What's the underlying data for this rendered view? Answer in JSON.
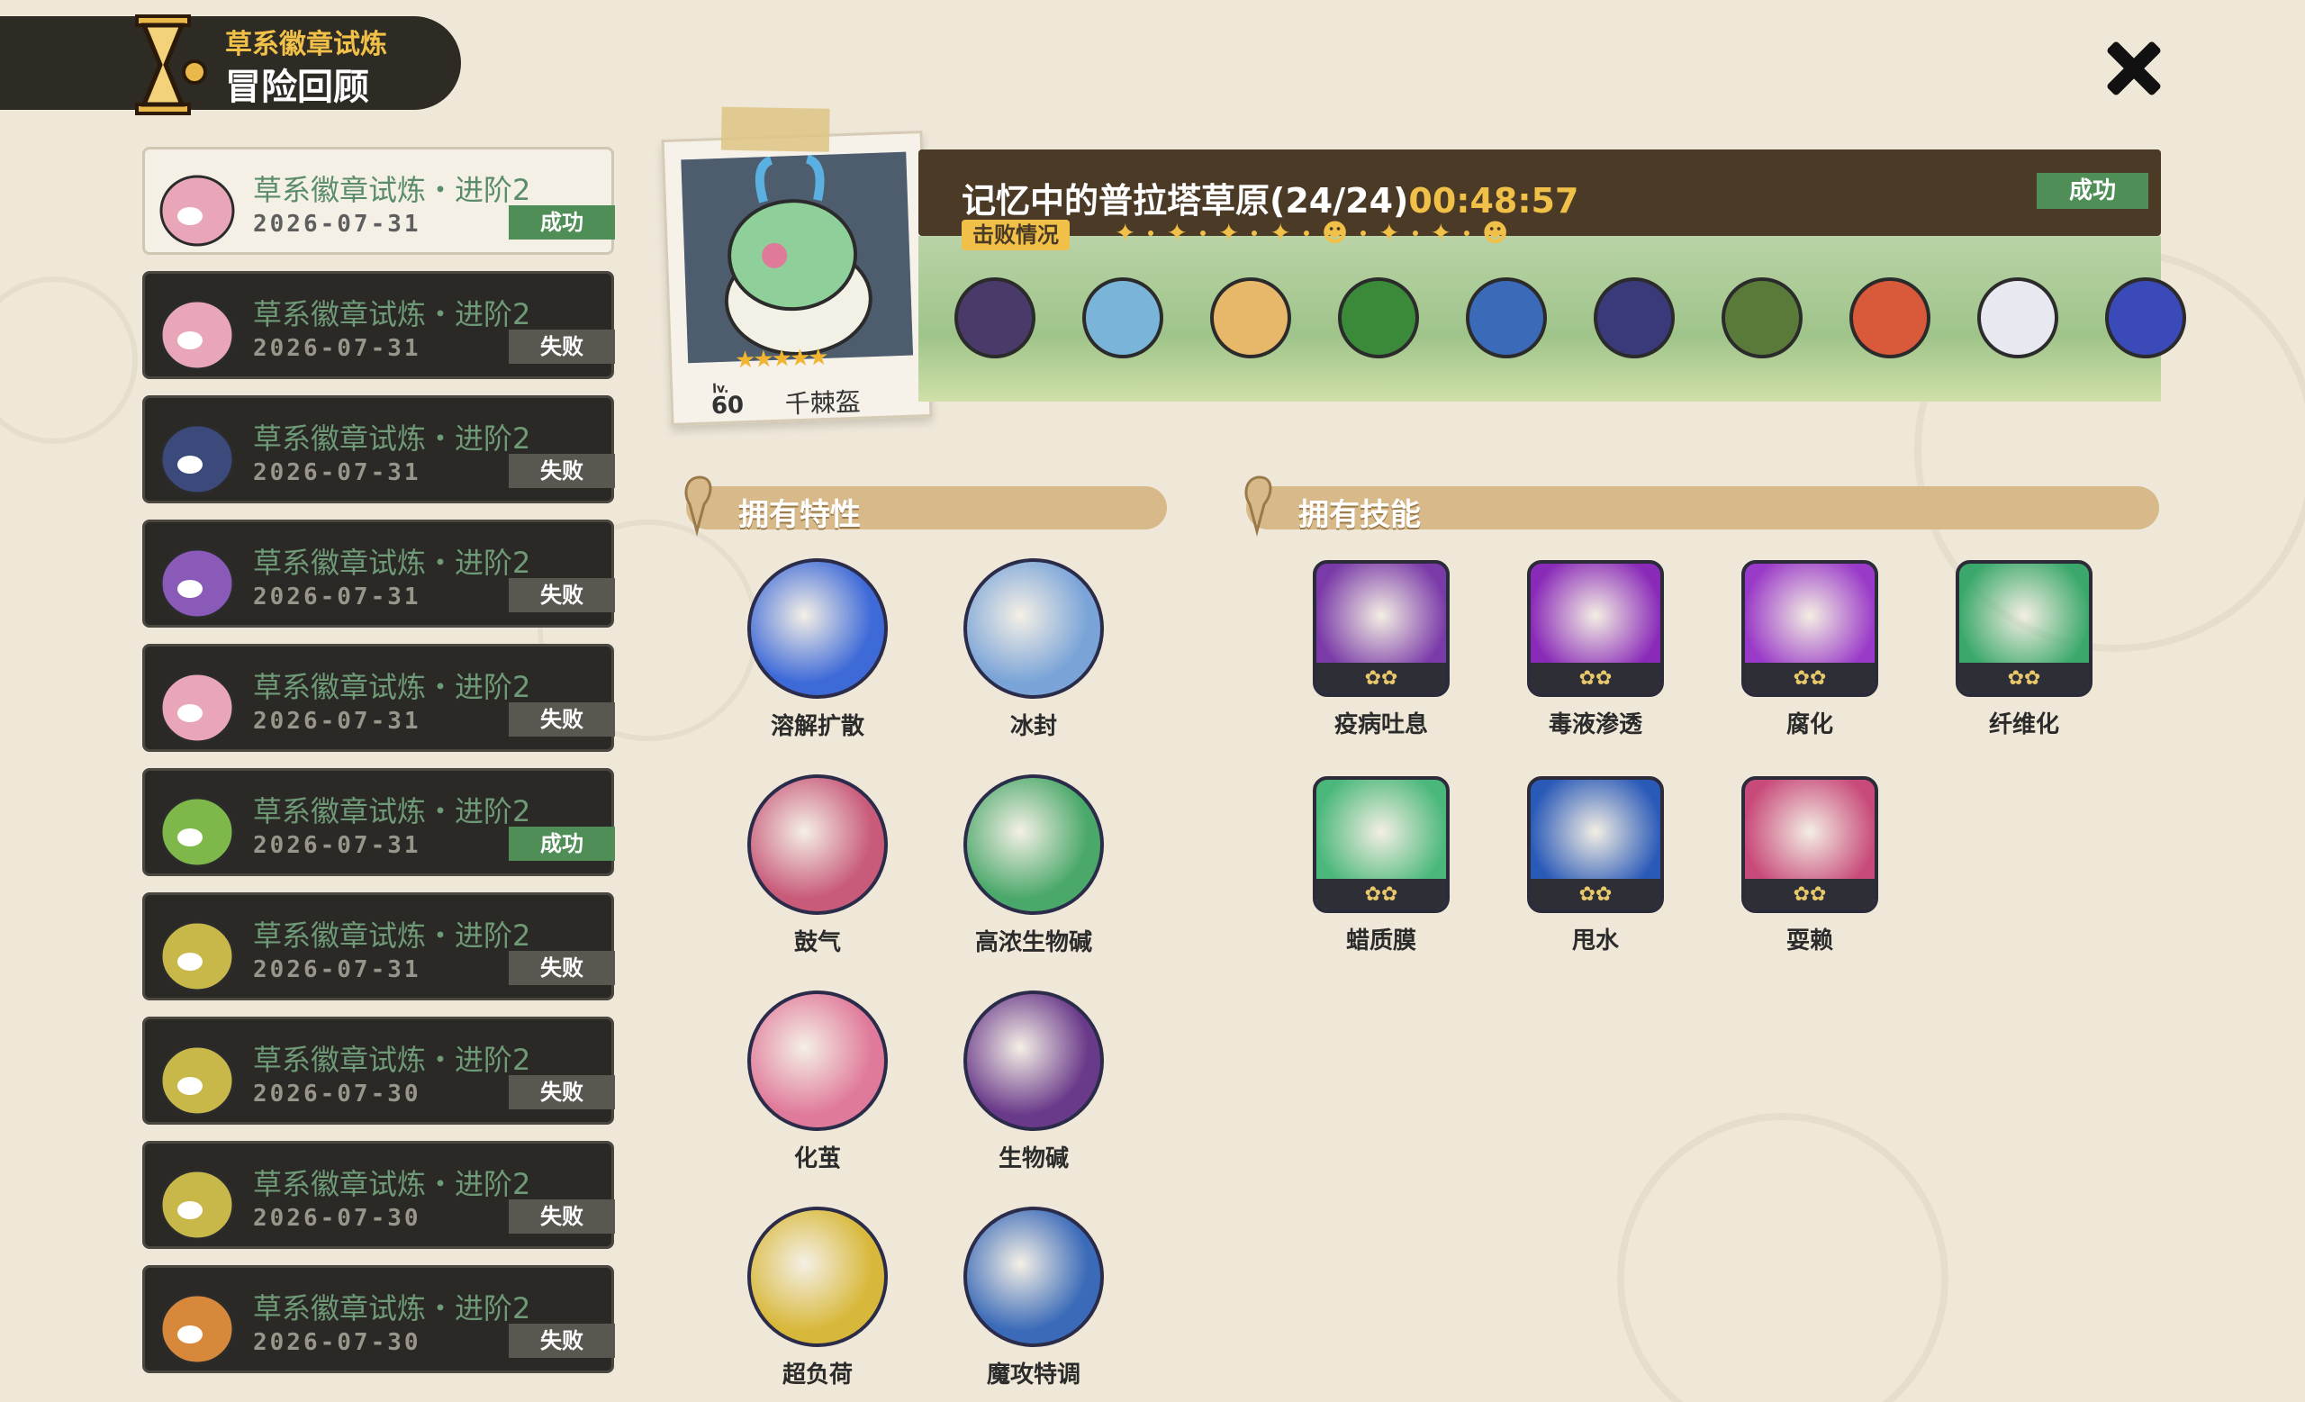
{
  "header": {
    "subtitle": "草系徽章试炼",
    "title": "冒险回顾"
  },
  "close": {
    "icon": "close-icon"
  },
  "records": [
    {
      "title": "草系徽章试炼・进阶2",
      "date": "2026-07-31",
      "result": "成功",
      "status": "success",
      "active": true,
      "avatar_color": "#e9a6b8"
    },
    {
      "title": "草系徽章试炼・进阶2",
      "date": "2026-07-31",
      "result": "失败",
      "status": "fail",
      "active": false,
      "avatar_color": "#e9a6b8"
    },
    {
      "title": "草系徽章试炼・进阶2",
      "date": "2026-07-31",
      "result": "失败",
      "status": "fail",
      "active": false,
      "avatar_color": "#3b4a7a"
    },
    {
      "title": "草系徽章试炼・进阶2",
      "date": "2026-07-31",
      "result": "失败",
      "status": "fail",
      "active": false,
      "avatar_color": "#8a5ab8"
    },
    {
      "title": "草系徽章试炼・进阶2",
      "date": "2026-07-31",
      "result": "失败",
      "status": "fail",
      "active": false,
      "avatar_color": "#e9a6b8"
    },
    {
      "title": "草系徽章试炼・进阶2",
      "date": "2026-07-31",
      "result": "成功",
      "status": "success",
      "active": false,
      "avatar_color": "#7fb84a"
    },
    {
      "title": "草系徽章试炼・进阶2",
      "date": "2026-07-31",
      "result": "失败",
      "status": "fail",
      "active": false,
      "avatar_color": "#c8b84a"
    },
    {
      "title": "草系徽章试炼・进阶2",
      "date": "2026-07-30",
      "result": "失败",
      "status": "fail",
      "active": false,
      "avatar_color": "#c8b84a"
    },
    {
      "title": "草系徽章试炼・进阶2",
      "date": "2026-07-30",
      "result": "失败",
      "status": "fail",
      "active": false,
      "avatar_color": "#c8b84a"
    },
    {
      "title": "草系徽章试炼・进阶2",
      "date": "2026-07-30",
      "result": "失败",
      "status": "fail",
      "active": false,
      "avatar_color": "#d8883a"
    }
  ],
  "pet": {
    "lv_label": "lv.",
    "level": "60",
    "name": "千棘盔",
    "stars": "★★★★★"
  },
  "stage": {
    "title": "记忆中的普拉塔草原(24/24)",
    "time": "00:48:57",
    "result": "成功",
    "defeat_label": "击败情况",
    "progress": [
      "✦",
      "✦",
      "✦",
      "✦",
      "☻",
      "✦",
      "✦",
      "☻"
    ]
  },
  "enemies": [
    {
      "name": "enemy-dark-bird",
      "color": "#4a3a6a"
    },
    {
      "name": "enemy-water-spirit",
      "color": "#7ab4d8"
    },
    {
      "name": "enemy-yellow-cat",
      "color": "#e8b86a"
    },
    {
      "name": "enemy-cactus",
      "color": "#3a8a3a"
    },
    {
      "name": "enemy-shield",
      "color": "#3a6ab8"
    },
    {
      "name": "enemy-witch",
      "color": "#3a3a7a"
    },
    {
      "name": "enemy-ranger",
      "color": "#5a7a3a"
    },
    {
      "name": "enemy-flame-cat",
      "color": "#d85a3a"
    },
    {
      "name": "enemy-snow-ghost",
      "color": "#e8e8f0"
    },
    {
      "name": "enemy-blue-partial",
      "color": "#3a4ab8"
    }
  ],
  "traits_section": {
    "label": "拥有特性"
  },
  "skills_section": {
    "label": "拥有技能"
  },
  "traits": [
    {
      "name": "溶解扩散",
      "color": "#3e6ad8"
    },
    {
      "name": "冰封",
      "color": "#7aa4d8"
    },
    {
      "name": "鼓气",
      "color": "#c85a7a"
    },
    {
      "name": "高浓生物碱",
      "color": "#4aa86a"
    },
    {
      "name": "化茧",
      "color": "#e07a9a"
    },
    {
      "name": "生物碱",
      "color": "#6a3a8a"
    },
    {
      "name": "超负荷",
      "color": "#d8b83a"
    },
    {
      "name": "魔攻特调",
      "color": "#3a6ab8"
    }
  ],
  "skills": [
    {
      "name": "疫病吐息",
      "color": "#7a3aa8",
      "pips": "✿✿"
    },
    {
      "name": "毒液渗透",
      "color": "#8a2ab8",
      "pips": "✿✿"
    },
    {
      "name": "腐化",
      "color": "#9a3ac8",
      "pips": "✿✿"
    },
    {
      "name": "纤维化",
      "color": "#3aa86a",
      "pips": "✿✿"
    },
    {
      "name": "蜡质膜",
      "color": "#4ab87a",
      "pips": "✿✿"
    },
    {
      "name": "甩水",
      "color": "#2a5ab8",
      "pips": "✿✿"
    },
    {
      "name": "耍赖",
      "color": "#c84a7a",
      "pips": "✿✿"
    }
  ]
}
